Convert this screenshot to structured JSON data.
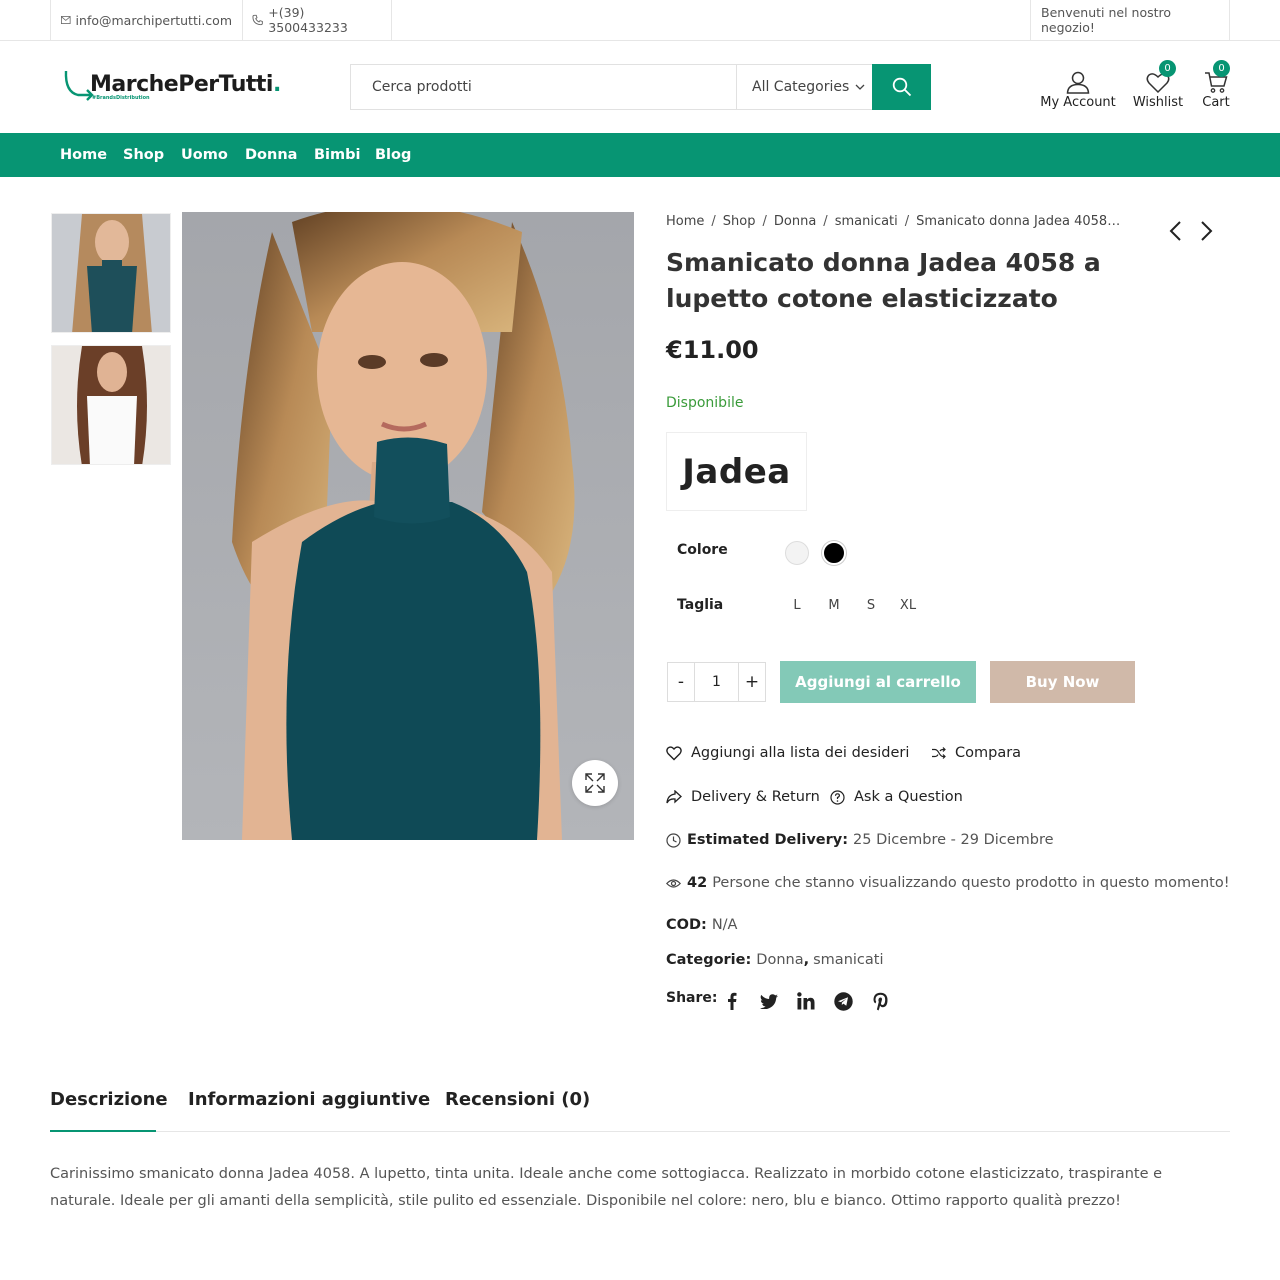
{
  "topbar": {
    "email": "info@marchipertutti.com",
    "phone": "+(39) 3500433233",
    "welcome": "Benvenuti nel nostro negozio!"
  },
  "header": {
    "logo_text": "MarchePerTutti",
    "logo_dot": ".",
    "logo_tagline": "#BrandsDistribution",
    "search_placeholder": "Cerca prodotti",
    "category_select": "All Categories",
    "account_label": "My Account",
    "wishlist_label": "Wishlist",
    "wishlist_count": "0",
    "cart_label": "Cart",
    "cart_count": "0"
  },
  "nav": {
    "items": [
      {
        "label": "Home"
      },
      {
        "label": "Shop"
      },
      {
        "label": "Uomo"
      },
      {
        "label": "Donna"
      },
      {
        "label": "Bimbi"
      },
      {
        "label": "Blog"
      }
    ]
  },
  "breadcrumb": [
    "Home",
    "Shop",
    "Donna",
    "smanicati",
    "Smanicato donna Jadea 4058…"
  ],
  "product": {
    "title": "Smanicato donna Jadea 4058 a lupetto cotone elasticizzato",
    "price": "€11.00",
    "stock": "Disponibile",
    "brand": "Jadea",
    "color_label": "Colore",
    "colors": [
      {
        "name": "bianco",
        "hex": "#f3f3f3"
      },
      {
        "name": "nero",
        "hex": "#000000"
      }
    ],
    "size_label": "Taglia",
    "sizes": [
      "L",
      "M",
      "S",
      "XL"
    ],
    "quantity": "1",
    "qty_minus": "-",
    "qty_plus": "+",
    "add_to_cart": "Aggiungi al carrello",
    "buy_now": "Buy Now",
    "wishlist_action": "Aggiungi alla lista dei desideri",
    "compare_action": "Compara",
    "delivery_action": "Delivery & Return",
    "question_action": "Ask a Question",
    "estimated_label": "Estimated Delivery:",
    "estimated_value": "25 Dicembre - 29 Dicembre",
    "viewers_count": "42",
    "viewers_text": "Persone che stanno visualizzando questo prodotto in questo momento!",
    "sku_label": "COD:",
    "sku_value": "N/A",
    "categories_label": "Categorie:",
    "categories": [
      "Donna",
      "smanicati"
    ],
    "categories_sep": ",",
    "share_label": "Share:"
  },
  "tabs": [
    {
      "label": "Descrizione",
      "active": true
    },
    {
      "label": "Informazioni aggiuntive",
      "active": false
    },
    {
      "label": "Recensioni (0)",
      "active": false
    }
  ],
  "description": "Carinissimo smanicato donna Jadea 4058. A lupetto, tinta unita. Ideale anche come sottogiacca. Realizzato in morbido cotone elasticizzato, traspirante e naturale. Ideale per gli amanti della semplicità, stile pulito ed essenziale. Disponibile nel colore: nero, blu e bianco. Ottimo rapporto qualità prezzo!",
  "colors": {
    "accent": "#079573",
    "add_to_cart_bg": "#83c9b7",
    "buy_now_bg": "#d0b9a9",
    "in_stock": "#3a9b3a"
  }
}
